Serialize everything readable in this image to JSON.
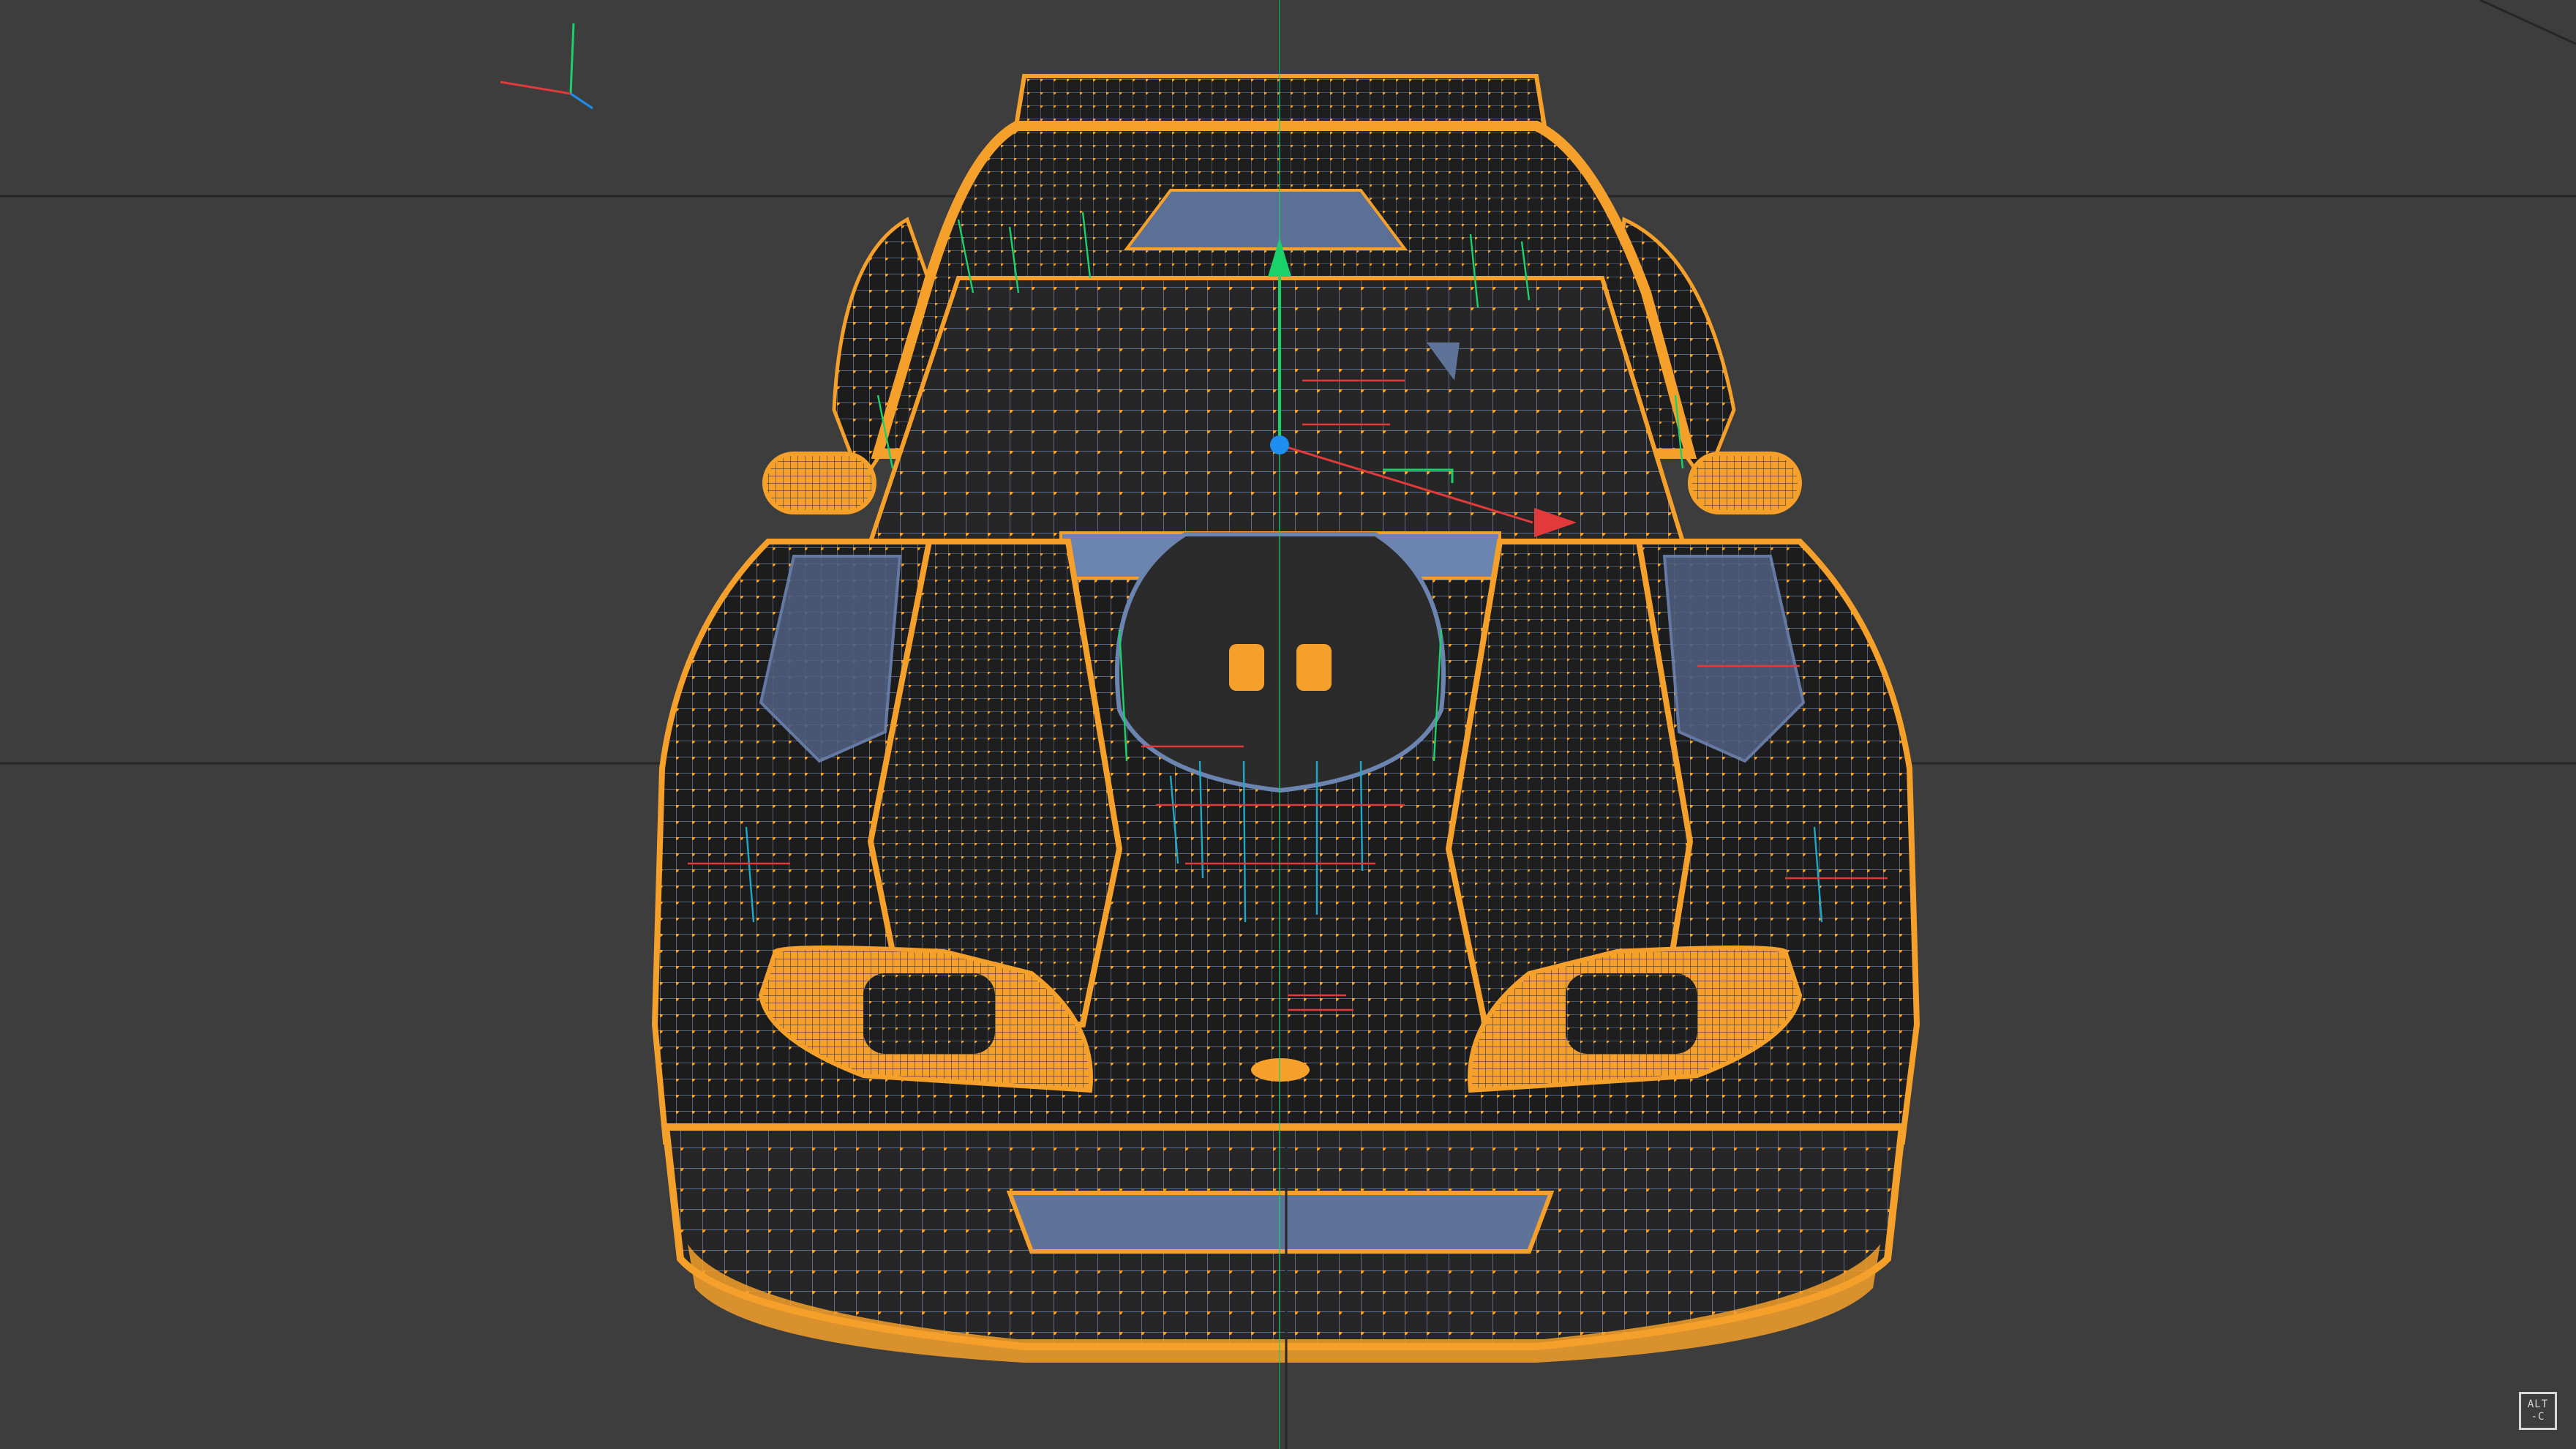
{
  "viewport": {
    "background": "#3d3d3d",
    "grid_color": "#2a2a2a",
    "mesh_color": "#f5a02a",
    "mesh_dark": "#1a1a1a",
    "edge_blue": "#6c8fb8",
    "axis_colors": {
      "x": "#e23a3a",
      "y": "#19d26a",
      "z": "#1e8ff0"
    }
  },
  "gizmo": {
    "icon": "move-gizmo-icon"
  },
  "axis_indicator": {
    "icon": "world-axis-icon"
  },
  "badge": {
    "line1": "ALT",
    "line2": "-C"
  }
}
